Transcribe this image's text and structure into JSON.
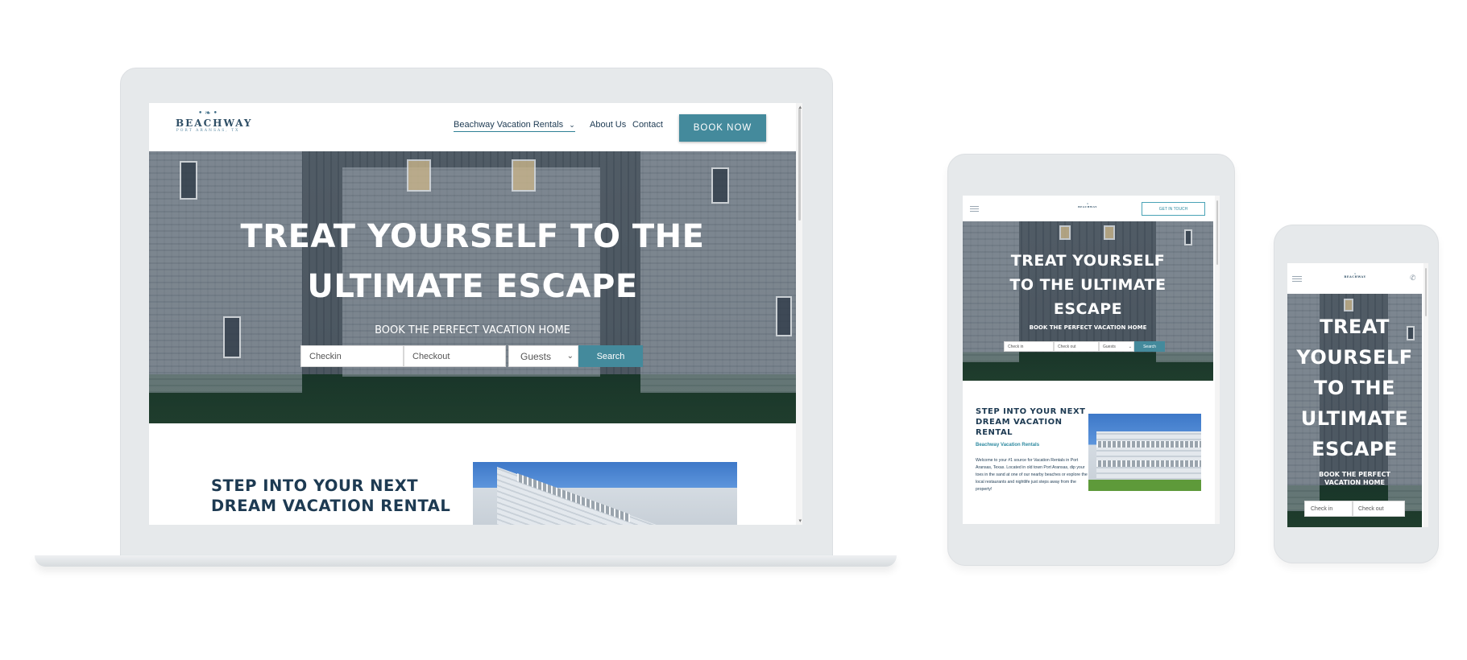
{
  "brand": {
    "name": "BEACHWAY",
    "location": "PORT ARANSAS, TX",
    "fish_glyph": "fish-logo"
  },
  "nav": {
    "primary": "Beachway Vacation Rentals",
    "about": "About Us",
    "contact": "Contact",
    "book_now": "BOOK NOW",
    "get_in_touch": "GET IN TOUCH"
  },
  "hero": {
    "title_line1": "TREAT YOURSELF TO THE",
    "title_line2": "ULTIMATE ESCAPE",
    "tablet_title": "TREAT YOURSELF TO THE ULTIMATE ESCAPE",
    "subtitle": "BOOK THE PERFECT VACATION HOME"
  },
  "search": {
    "checkin": "Checkin",
    "checkin_alt": "Check in",
    "checkout": "Checkout",
    "checkout_alt": "Check out",
    "guests": "Guests",
    "button": "Search"
  },
  "section": {
    "title_line1": "STEP INTO YOUR NEXT",
    "title_line2": "DREAM VACATION RENTAL",
    "tablet_title": "STEP INTO YOUR NEXT DREAM VACATION RENTAL",
    "link": "Beachway Vacation Rentals",
    "paragraph": "Welcome to your #1 source for Vacation Rentals in Port Aransas, Texas. Located in old town Port Aransas, dip your toes in the sand at one of our nearby beaches or explore the local restaurants and nightlife just steps away from the property!"
  },
  "colors": {
    "accent": "#448a9c",
    "heading": "#1d3a52",
    "device_frame": "#e6e9eb"
  }
}
